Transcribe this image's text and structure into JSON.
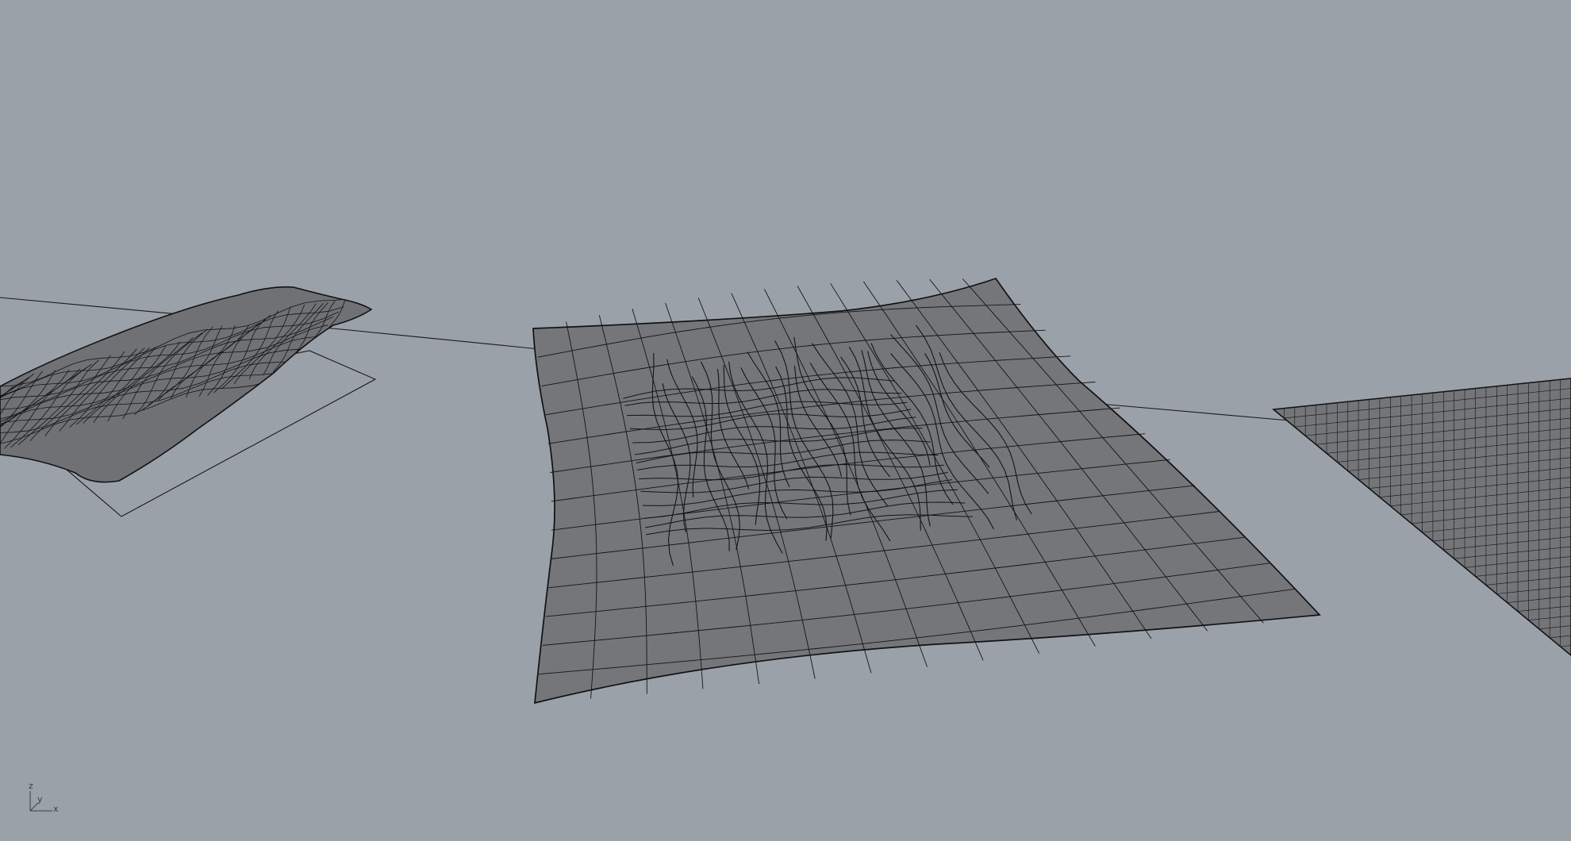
{
  "viewport": {
    "background": "#9aa1a9",
    "surface_fill": "#747679",
    "wire_color": "#141414"
  },
  "axis_widget": {
    "z_label": "z",
    "y_label": "y",
    "x_label": "x"
  }
}
